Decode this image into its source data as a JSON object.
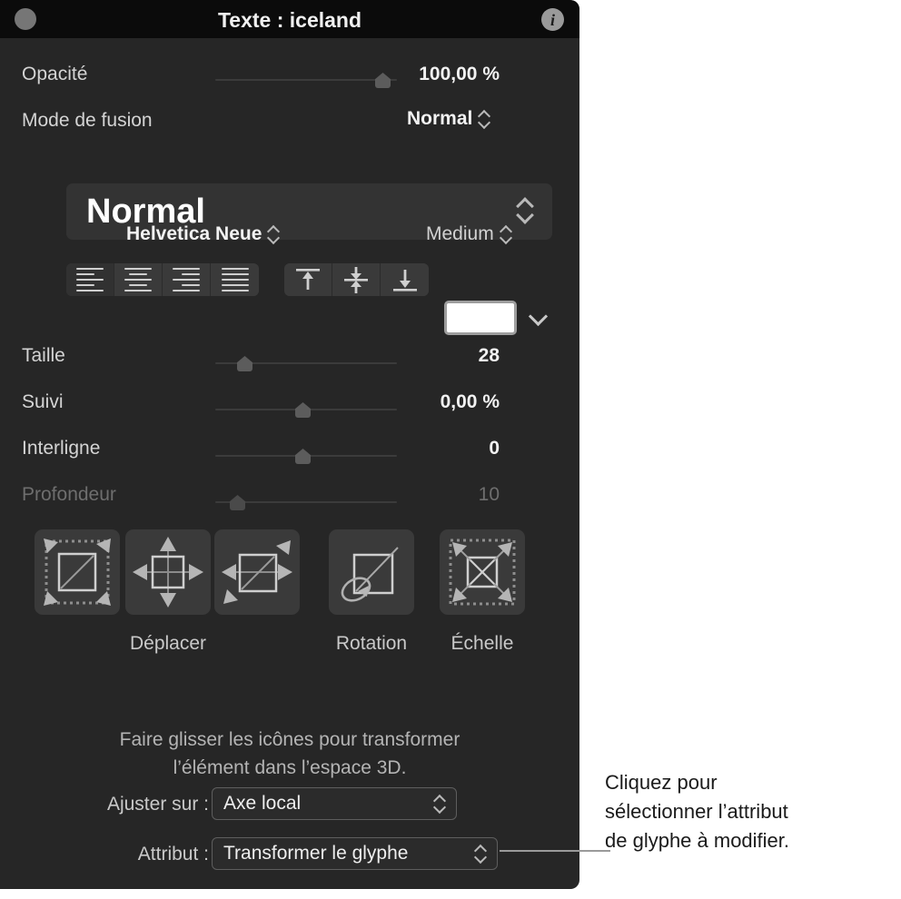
{
  "window": {
    "title": "Texte : iceland",
    "close_button": "close",
    "info_button": "i"
  },
  "opacity": {
    "label": "Opacité",
    "value": "100,00 %",
    "thumb_percent": 97
  },
  "blend": {
    "label": "Mode de fusion",
    "value": "Normal",
    "popup_value": "Normal"
  },
  "font": {
    "family": "Helvetica Neue",
    "style": "Medium"
  },
  "alignment": {
    "horizontal": [
      "align-left",
      "align-center",
      "align-right",
      "align-justify"
    ],
    "horizontal_selected": 0,
    "vertical": [
      "align-top",
      "align-middle",
      "align-bottom"
    ],
    "color_swatch": "#ffffff"
  },
  "sliders": [
    {
      "label": "Taille",
      "value": "28",
      "thumb_percent": 16,
      "disabled": false
    },
    {
      "label": "Suivi",
      "value": "0,00 %",
      "thumb_percent": 50,
      "disabled": false
    },
    {
      "label": "Interligne",
      "value": "0",
      "thumb_percent": 50,
      "disabled": false
    },
    {
      "label": "Profondeur",
      "value": "10",
      "thumb_percent": 9,
      "disabled": true
    }
  ],
  "transform": {
    "tiles": [
      {
        "icon": "move-free-icon"
      },
      {
        "icon": "move-axis-icon"
      },
      {
        "icon": "move-plane-icon"
      },
      {
        "icon": "rotate-icon"
      },
      {
        "icon": "scale-icon"
      }
    ],
    "labels": {
      "move": "Déplacer",
      "rotation": "Rotation",
      "scale": "Échelle"
    },
    "help_line1": "Faire glisser les icônes pour transformer",
    "help_line2": "l’élément dans l’espace 3D."
  },
  "bottom": {
    "adjust_label": "Ajuster sur :",
    "adjust_value": "Axe local",
    "attribute_label": "Attribut :",
    "attribute_value": "Transformer le glyphe"
  },
  "callout": {
    "line1": "Cliquez pour",
    "line2": "sélectionner l’attribut",
    "line3": "de glyphe à modifier."
  },
  "colors": {
    "panel_bg": "#262626",
    "titlebar_bg": "#0b0b0b",
    "accent_text": "#f2f2f2",
    "disabled_text": "#6e6e6e"
  }
}
